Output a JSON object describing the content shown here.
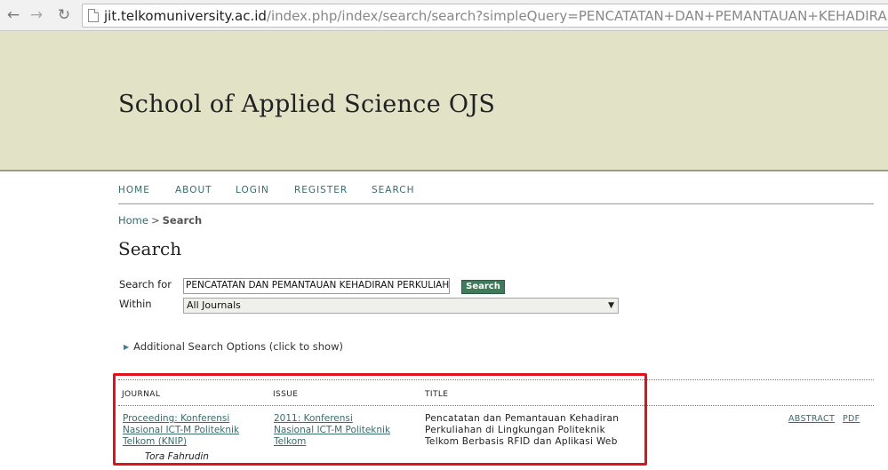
{
  "browser": {
    "url_domain": "jit.telkomuniversity.ac.id",
    "url_rest": "/index.php/index/search/search?simpleQuery=PENCATATAN+DAN+PEMANTAUAN+KEHADIRAN+PE"
  },
  "header": {
    "title": "School of Applied Science OJS"
  },
  "nav": {
    "home": "HOME",
    "about": "ABOUT",
    "login": "LOGIN",
    "register": "REGISTER",
    "search": "SEARCH"
  },
  "breadcrumb": {
    "home": "Home",
    "separator": ">",
    "current": "Search"
  },
  "page": {
    "heading": "Search"
  },
  "search_form": {
    "search_for_label": "Search for",
    "query": "PENCATATAN DAN PEMANTAUAN KEHADIRAN PERKULIAHAN",
    "button_label": "Search",
    "within_label": "Within",
    "within_value": "All Journals",
    "additional_options": "Additional Search Options (click to show)"
  },
  "results": {
    "headers": {
      "journal": "JOURNAL",
      "issue": "ISSUE",
      "title": "TITLE"
    },
    "rows": [
      {
        "journal_lines": [
          "Proceeding: Konferensi",
          "Nasional ICT-M Politeknik",
          "Telkom (KNIP)"
        ],
        "issue_lines": [
          "2011: Konferensi",
          "Nasional ICT-M Politeknik",
          "Telkom"
        ],
        "title_lines": [
          "Pencatatan dan Pemantauan Kehadiran",
          "Perkuliahan di Lingkungan Politeknik",
          "Telkom Berbasis RFID dan Aplikasi Web"
        ],
        "abstract_label": "ABSTRACT",
        "pdf_label": "PDF",
        "author": "Tora Fahrudin"
      }
    ]
  },
  "colors": {
    "header_bg": "#e2e3c6",
    "link": "#3a6b6b",
    "button_bg": "#3f7a5b",
    "highlight": "#e0121b"
  }
}
